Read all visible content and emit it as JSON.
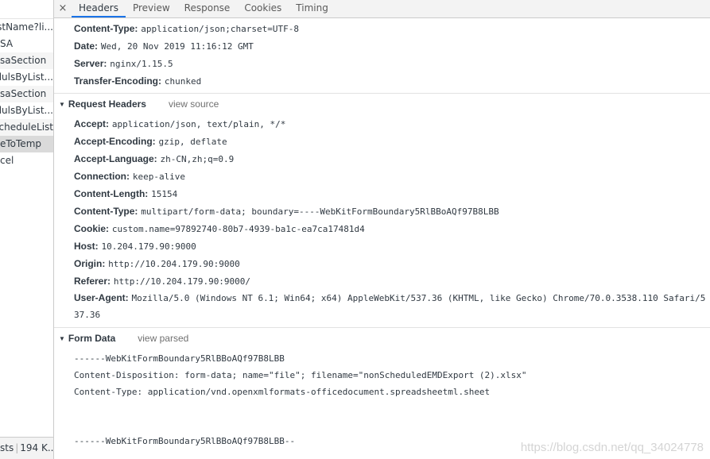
{
  "request_list": {
    "items": [
      "istName?li...",
      "SA",
      "saSection",
      "alulsByList...",
      "saSection",
      "alulsByList...",
      "cheduleList",
      "eToTemp",
      "cel"
    ],
    "selected_index": 7,
    "status": {
      "left": "sts",
      "right": "194 K..."
    }
  },
  "tabs": {
    "close_icon": "×",
    "items": [
      "Headers",
      "Preview",
      "Response",
      "Cookies",
      "Timing"
    ],
    "active": "Headers"
  },
  "response_headers": [
    {
      "name": "Content-Type:",
      "value": "application/json;charset=UTF-8"
    },
    {
      "name": "Date:",
      "value": "Wed, 20 Nov 2019 11:16:12 GMT"
    },
    {
      "name": "Server:",
      "value": "nginx/1.15.5"
    },
    {
      "name": "Transfer-Encoding:",
      "value": "chunked"
    }
  ],
  "request_headers": {
    "title": "Request Headers",
    "link": "view source",
    "rows": [
      {
        "name": "Accept:",
        "value": "application/json, text/plain, */*"
      },
      {
        "name": "Accept-Encoding:",
        "value": "gzip, deflate"
      },
      {
        "name": "Accept-Language:",
        "value": "zh-CN,zh;q=0.9"
      },
      {
        "name": "Connection:",
        "value": "keep-alive"
      },
      {
        "name": "Content-Length:",
        "value": "15154"
      },
      {
        "name": "Content-Type:",
        "value": "multipart/form-data; boundary=----WebKitFormBoundary5RlBBoAQf97B8LBB"
      },
      {
        "name": "Cookie:",
        "value": "custom.name=97892740-80b7-4939-ba1c-ea7ca17481d4"
      },
      {
        "name": "Host:",
        "value": "10.204.179.90:9000"
      },
      {
        "name": "Origin:",
        "value": "http://10.204.179.90:9000"
      },
      {
        "name": "Referer:",
        "value": "http://10.204.179.90:9000/"
      },
      {
        "name": "User-Agent:",
        "value": "Mozilla/5.0 (Windows NT 6.1; Win64; x64) AppleWebKit/537.36 (KHTML, like Gecko) Chrome/70.0.3538.110 Safari/537.36"
      }
    ]
  },
  "form_data": {
    "title": "Form Data",
    "link": "view parsed",
    "lines": [
      "------WebKitFormBoundary5RlBBoAQf97B8LBB",
      "Content-Disposition: form-data; name=\"file\"; filename=\"nonScheduledEMDExport (2).xlsx\"",
      "Content-Type: application/vnd.openxmlformats-officedocument.spreadsheetml.sheet",
      "------WebKitFormBoundary5RlBBoAQf97B8LBB--"
    ]
  },
  "watermark": "https://blog.csdn.net/qq_34024778",
  "colors": {
    "active_tab": "#1a73e8",
    "selected_row": "#dadada"
  }
}
